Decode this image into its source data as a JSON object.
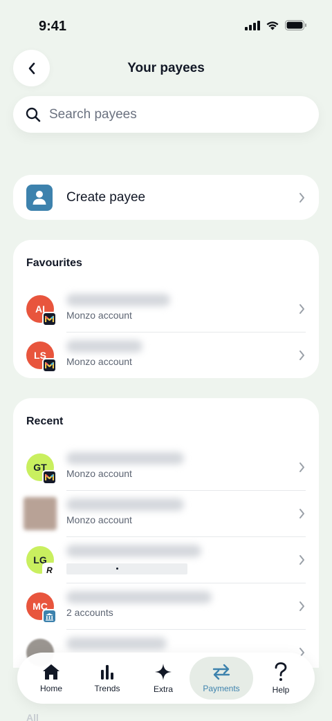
{
  "status_bar": {
    "time": "9:41"
  },
  "header": {
    "title": "Your payees"
  },
  "search": {
    "placeholder": "Search payees"
  },
  "create_payee": {
    "label": "Create payee"
  },
  "favourites": {
    "title": "Favourites",
    "items": [
      {
        "initials": "AI",
        "avatar_color": "#e8553d",
        "subtitle": "Monzo account",
        "badge": "monzo"
      },
      {
        "initials": "LS",
        "avatar_color": "#e8553d",
        "subtitle": "Monzo account",
        "badge": "monzo"
      }
    ]
  },
  "recent": {
    "title": "Recent",
    "items": [
      {
        "initials": "GT",
        "avatar_color": "#c9ef5f",
        "subtitle": "Monzo account",
        "badge": "monzo"
      },
      {
        "initials": "",
        "avatar_color": "#b8a296",
        "subtitle": "Monzo account",
        "badge": "none"
      },
      {
        "initials": "LG",
        "avatar_color": "#c9ef5f",
        "subtitle": "",
        "badge": "revolut"
      },
      {
        "initials": "MC",
        "avatar_color": "#e8553d",
        "subtitle": "2 accounts",
        "badge": "bank"
      },
      {
        "initials": "",
        "avatar_color": "#9a9590",
        "subtitle": "",
        "badge": "none"
      }
    ]
  },
  "tab_bar": {
    "items": [
      {
        "label": "Home",
        "icon": "home-icon"
      },
      {
        "label": "Trends",
        "icon": "bar-chart-icon"
      },
      {
        "label": "Extra",
        "icon": "sparkle-icon"
      },
      {
        "label": "Payments",
        "icon": "transfer-arrows-icon",
        "active": true
      },
      {
        "label": "Help",
        "icon": "question-icon"
      }
    ]
  },
  "bottom_hint": "All",
  "colors": {
    "accent": "#3d82ad",
    "background": "#eef4ee",
    "coral": "#e8553d",
    "lime": "#c9ef5f"
  }
}
